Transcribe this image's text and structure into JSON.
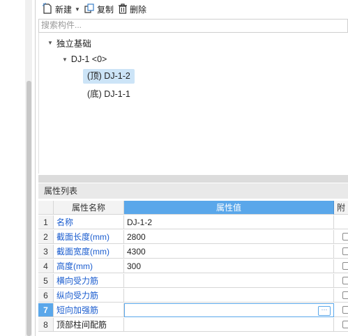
{
  "toolbar": {
    "new_label": "新建",
    "copy_label": "复制",
    "delete_label": "删除"
  },
  "search": {
    "placeholder": "搜索构件..."
  },
  "tree": {
    "root": "独立基础",
    "group": "DJ-1 <0>",
    "children": [
      {
        "label": "(顶)  DJ-1-2",
        "selected": true
      },
      {
        "label": "(底)  DJ-1-1",
        "selected": false
      }
    ]
  },
  "properties": {
    "title": "属性列表",
    "headers": {
      "name": "属性名称",
      "value": "属性值",
      "attach": "附"
    },
    "rows": [
      {
        "idx": "1",
        "name": "名称",
        "value": "DJ-1-2",
        "has_check": false
      },
      {
        "idx": "2",
        "name": "截面长度(mm)",
        "value": "2800",
        "has_check": true
      },
      {
        "idx": "3",
        "name": "截面宽度(mm)",
        "value": "4300",
        "has_check": true
      },
      {
        "idx": "4",
        "name": "高度(mm)",
        "value": "300",
        "has_check": true
      },
      {
        "idx": "5",
        "name": "横向受力筋",
        "value": "",
        "has_check": true
      },
      {
        "idx": "6",
        "name": "纵向受力筋",
        "value": "",
        "has_check": true
      },
      {
        "idx": "7",
        "name": "短向加强筋",
        "value": "",
        "has_check": true,
        "active": true,
        "more_button": "···"
      },
      {
        "idx": "8",
        "name": "顶部柱间配筋",
        "value": "",
        "has_check": true
      }
    ]
  },
  "colors": {
    "accent": "#5aa7ea",
    "link_text": "#1a5ccf",
    "selection": "#cce4f7"
  }
}
